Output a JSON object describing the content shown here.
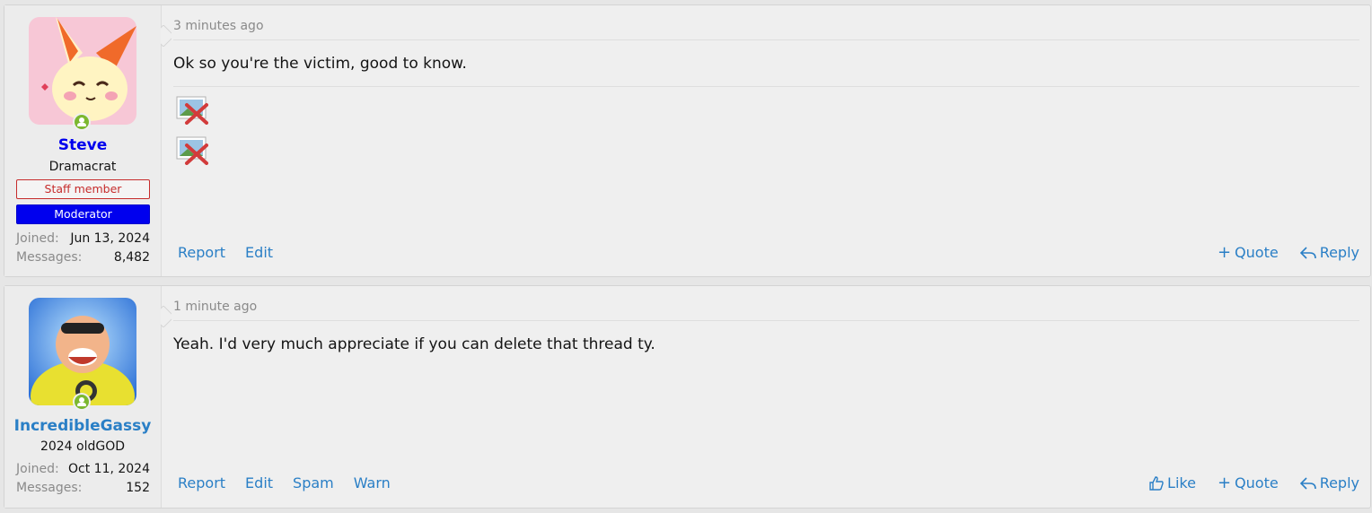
{
  "posts": [
    {
      "author": "Steve",
      "author_color": "#0000ee",
      "user_title": "Dramacrat",
      "badges": [
        "Staff member",
        "Moderator"
      ],
      "joined_label": "Joined:",
      "joined": "Jun 13, 2024",
      "messages_label": "Messages:",
      "messages": "8,482",
      "time": "3 minutes ago",
      "message": "Ok so you're the victim, good to know.",
      "actions_left": [
        "Report",
        "Edit"
      ],
      "actions_right": [
        "Quote",
        "Reply"
      ]
    },
    {
      "author": "IncredibleGassy",
      "author_color": "#2a7fc6",
      "user_title": "2024 oldGOD",
      "joined_label": "Joined:",
      "joined": "Oct 11, 2024",
      "messages_label": "Messages:",
      "messages": "152",
      "time": "1 minute ago",
      "message": "Yeah. I'd very much appreciate if you can delete that thread ty.",
      "actions_left": [
        "Report",
        "Edit",
        "Spam",
        "Warn"
      ],
      "actions_right": [
        "Like",
        "Quote",
        "Reply"
      ]
    }
  ],
  "icons": {
    "online": "online-user-icon",
    "broken_image": "broken-image-icon",
    "quote": "plus-icon",
    "reply": "reply-arrow-icon",
    "like": "thumbs-up-icon"
  },
  "colors": {
    "link": "#2a7fc6",
    "staff": "#c62c2c",
    "moderator": "#0000ee",
    "online": "#7cb82f"
  }
}
